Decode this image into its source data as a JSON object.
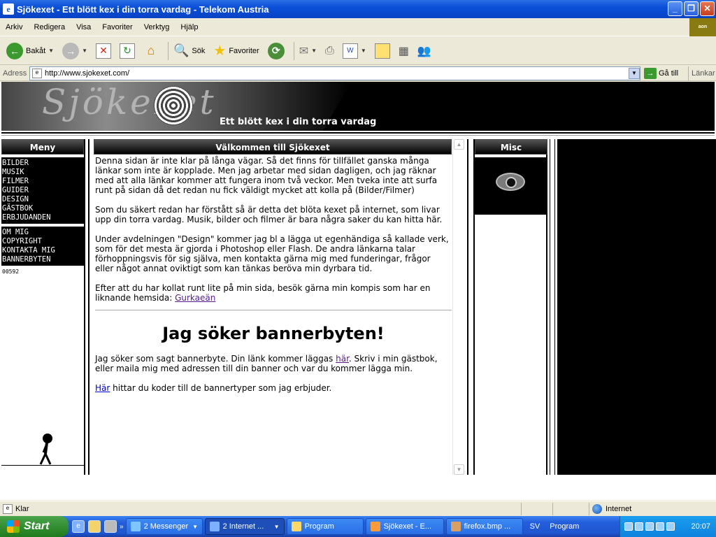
{
  "window": {
    "title": "Sjökexet - Ett blött kex i din torra vardag - Telekom Austria",
    "icon": "ie-icon",
    "controls": [
      "minimize",
      "maximize",
      "close"
    ]
  },
  "menu": {
    "items": [
      "Arkiv",
      "Redigera",
      "Visa",
      "Favoriter",
      "Verktyg",
      "Hjälp"
    ],
    "brand": "aon"
  },
  "toolbar": {
    "back_label": "Bakåt",
    "search_label": "Sök",
    "favorites_label": "Favoriter"
  },
  "address": {
    "label": "Adress",
    "url": "http://www.sjokexet.com/",
    "go_label": "Gå till",
    "links_label": "Länkar"
  },
  "page": {
    "banner_tagline": "Ett blött kex i din torra vardag",
    "banner_logo": "Sjökexet",
    "left": {
      "header": "Meny",
      "menu1": [
        "BILDER",
        "MUSIK",
        "FILMER",
        "GUIDER",
        "DESIGN",
        "GÄSTBOK",
        "ERBJUDANDEN"
      ],
      "menu2": [
        "OM MIG",
        "COPYRIGHT",
        "KONTAKTA MIG",
        "BANNERBYTEN"
      ],
      "counter": "00592"
    },
    "main": {
      "header": "Välkommen till Sjökexet",
      "p1": "Denna sidan är inte klar på långa vägar. Så det finns för tillfället ganska många länkar som inte är kopplade. Men jag arbetar med sidan dagligen, och jag räknar med att alla länkar kommer att fungera inom två veckor. Men tveka inte att surfa runt på sidan då det redan nu fick väldigt mycket att kolla på (Bilder/Filmer)",
      "p2": "Som du säkert redan har förstått så är detta det blöta kexet på internet, som livar upp din torra vardag. Musik, bilder och filmer är bara några saker du kan hitta här.",
      "p3": "Under avdelningen \"Design\" kommer jag bl a lägga ut egenhändiga så kallade verk, som för det mesta är gjorda i Photoshop eller Flash. De andra länkarna talar förhoppningsvis för sig själva, men kontakta gärna mig med funderingar, frågor eller något annat oviktigt som kan tänkas beröva min dyrbara tid.",
      "p4_text": "Efter att du har kollat runt lite på min sida, besök gärna min kompis som har en liknande hemsida: ",
      "p4_link": "Gurkaeän",
      "big_title": "Jag söker bannerbyten!",
      "p5_text_a": "Jag söker som sagt bannerbyte. Din länk kommer läggas ",
      "p5_link": "här",
      "p5_text_b": ". Skriv i min gästbok, eller maila mig med adressen till din banner och var du kommer lägga min.",
      "p6_link": "Här",
      "p6_text": " hittar du koder till de bannertyper som jag erbjuder."
    },
    "misc": {
      "header": "Misc"
    }
  },
  "status": {
    "text": "Klar",
    "zone": "Internet"
  },
  "taskbar": {
    "start_label": "Start",
    "buttons": [
      {
        "label": "2 Messenger",
        "active": false
      },
      {
        "label": "2 Internet ...",
        "active": true
      },
      {
        "label": "Program",
        "active": false
      },
      {
        "label": "Sjökexet - E...",
        "active": false
      },
      {
        "label": "firefox.bmp ...",
        "active": false
      }
    ],
    "lang": "SV",
    "program_label": "Program",
    "clock": "20:07"
  },
  "colors": {
    "titlebar": "#0a4fd8",
    "link_visited": "#551a8b",
    "link": "#0000cc",
    "taskbar": "#245edb",
    "start": "#2f8b2e"
  }
}
